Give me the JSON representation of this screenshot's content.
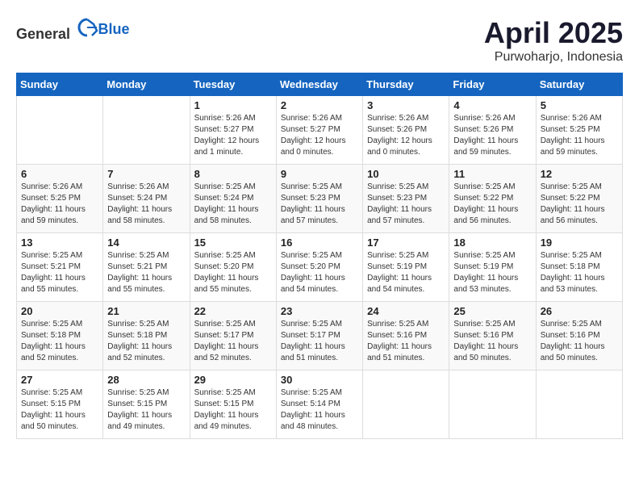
{
  "header": {
    "logo_general": "General",
    "logo_blue": "Blue",
    "month_year": "April 2025",
    "location": "Purwoharjo, Indonesia"
  },
  "weekdays": [
    "Sunday",
    "Monday",
    "Tuesday",
    "Wednesday",
    "Thursday",
    "Friday",
    "Saturday"
  ],
  "weeks": [
    [
      {
        "day": "",
        "info": ""
      },
      {
        "day": "",
        "info": ""
      },
      {
        "day": "1",
        "info": "Sunrise: 5:26 AM\nSunset: 5:27 PM\nDaylight: 12 hours and 1 minute."
      },
      {
        "day": "2",
        "info": "Sunrise: 5:26 AM\nSunset: 5:27 PM\nDaylight: 12 hours and 0 minutes."
      },
      {
        "day": "3",
        "info": "Sunrise: 5:26 AM\nSunset: 5:26 PM\nDaylight: 12 hours and 0 minutes."
      },
      {
        "day": "4",
        "info": "Sunrise: 5:26 AM\nSunset: 5:26 PM\nDaylight: 11 hours and 59 minutes."
      },
      {
        "day": "5",
        "info": "Sunrise: 5:26 AM\nSunset: 5:25 PM\nDaylight: 11 hours and 59 minutes."
      }
    ],
    [
      {
        "day": "6",
        "info": "Sunrise: 5:26 AM\nSunset: 5:25 PM\nDaylight: 11 hours and 59 minutes."
      },
      {
        "day": "7",
        "info": "Sunrise: 5:26 AM\nSunset: 5:24 PM\nDaylight: 11 hours and 58 minutes."
      },
      {
        "day": "8",
        "info": "Sunrise: 5:25 AM\nSunset: 5:24 PM\nDaylight: 11 hours and 58 minutes."
      },
      {
        "day": "9",
        "info": "Sunrise: 5:25 AM\nSunset: 5:23 PM\nDaylight: 11 hours and 57 minutes."
      },
      {
        "day": "10",
        "info": "Sunrise: 5:25 AM\nSunset: 5:23 PM\nDaylight: 11 hours and 57 minutes."
      },
      {
        "day": "11",
        "info": "Sunrise: 5:25 AM\nSunset: 5:22 PM\nDaylight: 11 hours and 56 minutes."
      },
      {
        "day": "12",
        "info": "Sunrise: 5:25 AM\nSunset: 5:22 PM\nDaylight: 11 hours and 56 minutes."
      }
    ],
    [
      {
        "day": "13",
        "info": "Sunrise: 5:25 AM\nSunset: 5:21 PM\nDaylight: 11 hours and 55 minutes."
      },
      {
        "day": "14",
        "info": "Sunrise: 5:25 AM\nSunset: 5:21 PM\nDaylight: 11 hours and 55 minutes."
      },
      {
        "day": "15",
        "info": "Sunrise: 5:25 AM\nSunset: 5:20 PM\nDaylight: 11 hours and 55 minutes."
      },
      {
        "day": "16",
        "info": "Sunrise: 5:25 AM\nSunset: 5:20 PM\nDaylight: 11 hours and 54 minutes."
      },
      {
        "day": "17",
        "info": "Sunrise: 5:25 AM\nSunset: 5:19 PM\nDaylight: 11 hours and 54 minutes."
      },
      {
        "day": "18",
        "info": "Sunrise: 5:25 AM\nSunset: 5:19 PM\nDaylight: 11 hours and 53 minutes."
      },
      {
        "day": "19",
        "info": "Sunrise: 5:25 AM\nSunset: 5:18 PM\nDaylight: 11 hours and 53 minutes."
      }
    ],
    [
      {
        "day": "20",
        "info": "Sunrise: 5:25 AM\nSunset: 5:18 PM\nDaylight: 11 hours and 52 minutes."
      },
      {
        "day": "21",
        "info": "Sunrise: 5:25 AM\nSunset: 5:18 PM\nDaylight: 11 hours and 52 minutes."
      },
      {
        "day": "22",
        "info": "Sunrise: 5:25 AM\nSunset: 5:17 PM\nDaylight: 11 hours and 52 minutes."
      },
      {
        "day": "23",
        "info": "Sunrise: 5:25 AM\nSunset: 5:17 PM\nDaylight: 11 hours and 51 minutes."
      },
      {
        "day": "24",
        "info": "Sunrise: 5:25 AM\nSunset: 5:16 PM\nDaylight: 11 hours and 51 minutes."
      },
      {
        "day": "25",
        "info": "Sunrise: 5:25 AM\nSunset: 5:16 PM\nDaylight: 11 hours and 50 minutes."
      },
      {
        "day": "26",
        "info": "Sunrise: 5:25 AM\nSunset: 5:16 PM\nDaylight: 11 hours and 50 minutes."
      }
    ],
    [
      {
        "day": "27",
        "info": "Sunrise: 5:25 AM\nSunset: 5:15 PM\nDaylight: 11 hours and 50 minutes."
      },
      {
        "day": "28",
        "info": "Sunrise: 5:25 AM\nSunset: 5:15 PM\nDaylight: 11 hours and 49 minutes."
      },
      {
        "day": "29",
        "info": "Sunrise: 5:25 AM\nSunset: 5:15 PM\nDaylight: 11 hours and 49 minutes."
      },
      {
        "day": "30",
        "info": "Sunrise: 5:25 AM\nSunset: 5:14 PM\nDaylight: 11 hours and 48 minutes."
      },
      {
        "day": "",
        "info": ""
      },
      {
        "day": "",
        "info": ""
      },
      {
        "day": "",
        "info": ""
      }
    ]
  ]
}
